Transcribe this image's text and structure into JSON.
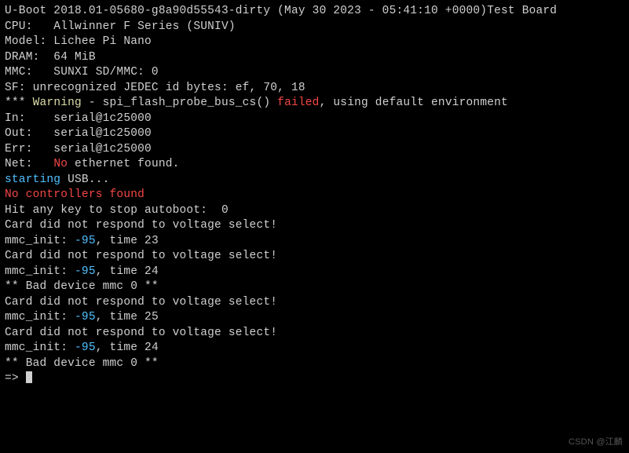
{
  "boot_line": "U-Boot 2018.01-05680-g8a90d55543-dirty (May 30 2023 - 05:41:10 +0000)Test Board",
  "blank": "",
  "cpu_line": "CPU:   Allwinner F Series (SUNIV)",
  "model_line": "Model: Lichee Pi Nano",
  "dram_line": "DRAM:  64 MiB",
  "mmc_line": "MMC:   SUNXI SD/MMC: 0",
  "sf_line": "SF: unrecognized JEDEC id bytes: ef, 70, 18",
  "warn_prefix": "*** ",
  "warn_word": "Warning",
  "warn_mid": " - spi_flash_probe_bus_cs() ",
  "warn_failed": "failed",
  "warn_suffix": ", using default environment",
  "in_line": "In:    serial@1c25000",
  "out_line": "Out:   serial@1c25000",
  "err_line": "Err:   serial@1c25000",
  "net_prefix": "Net:   ",
  "net_no": "No",
  "net_suffix": " ethernet found.",
  "usb_start": "starting",
  "usb_suffix": " USB...",
  "no_controllers": "No controllers found",
  "autoboot": "Hit any key to stop autoboot:  0 ",
  "card_no_respond": "Card did not respond to voltage select!",
  "mmc_a": "mmc_init: ",
  "neg95": "-95",
  "time23": ", time 23",
  "time24": ", time 24",
  "time25": ", time 25",
  "bad_dev": "** Bad device mmc 0 **",
  "prompt": "=> ",
  "watermark": "CSDN @江麟"
}
